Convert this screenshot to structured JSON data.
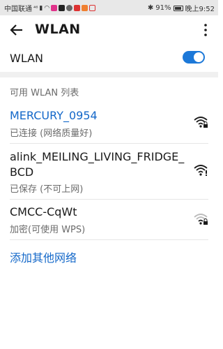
{
  "status_bar": {
    "carrier": "中国联通",
    "carrier_suffix": "⁴⁶",
    "battery": "91%",
    "time": "晚上9:52"
  },
  "app_bar": {
    "title": "WLAN"
  },
  "wlan_toggle": {
    "label": "WLAN",
    "enabled": true
  },
  "section_title": "可用 WLAN 列表",
  "networks": [
    {
      "name": "MERCURY_0954",
      "status": "已连接 (网络质量好)",
      "connected": true,
      "locked": true
    },
    {
      "name": "alink_MEILING_LIVING_FRIDGE_",
      "name_line2": "BCD",
      "status": "已保存 (不可上网)",
      "connected": false,
      "locked": false
    },
    {
      "name": "CMCC-CqWt",
      "status": "加密(可使用 WPS)",
      "connected": false,
      "locked": true
    }
  ],
  "add_network": "添加其他网络",
  "colors": {
    "accent": "#1468c9",
    "toggle": "#1c78d8"
  }
}
